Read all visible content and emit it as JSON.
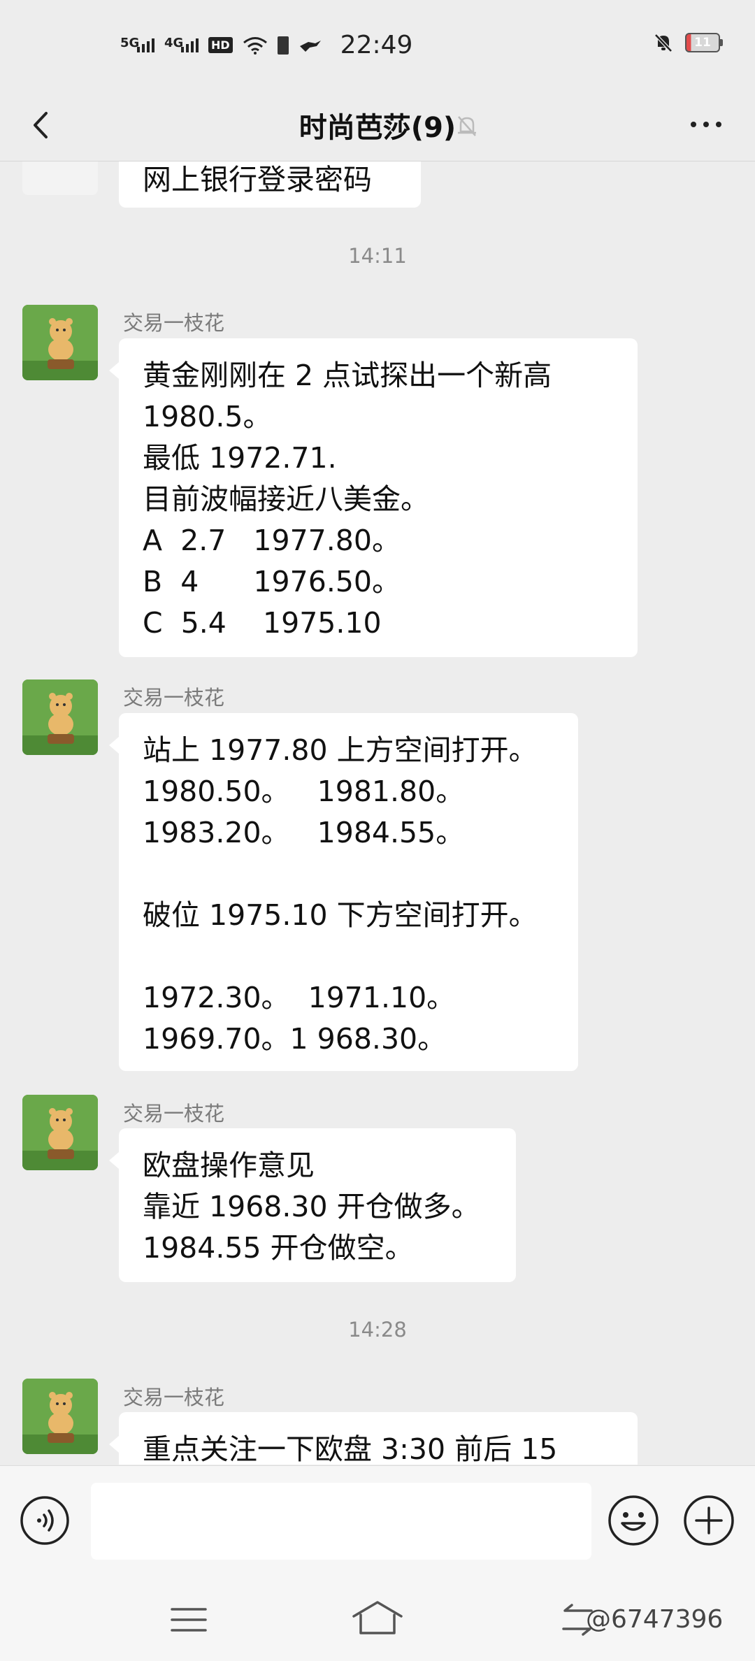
{
  "status_bar": {
    "net1": "5G",
    "net2": "4G",
    "hd": "HD",
    "time": "22:49",
    "battery_level": "11"
  },
  "header": {
    "title": "时尚芭莎(9)",
    "back_icon": "chevron-left-icon",
    "mute_icon": "bell-off-icon",
    "more_icon": "more-dots-icon"
  },
  "messages": [
    {
      "partial": true,
      "text": "网上银行登录密码"
    },
    {
      "timestamp": "14:11"
    },
    {
      "sender": "交易一枝花",
      "text": "黄金刚刚在 2 点试探出一个新高\n1980.5。\n最低 1972.71.\n目前波幅接近八美金。\nA  2.7   1977.80。\nB  4      1976.50。\nC  5.4    1975.10"
    },
    {
      "sender": "交易一枝花",
      "text": "站上 1977.80 上方空间打开。\n1980.50。   1981.80。\n1983.20。   1984.55。\n\n破位 1975.10 下方空间打开。\n\n1972.30。  1971.10。\n1969.70。1 968.30。"
    },
    {
      "sender": "交易一枝花",
      "text": "欧盘操作意见\n靠近 1968.30 开仓做多。\n1984.55 开仓做空。"
    },
    {
      "timestamp": "14:28"
    },
    {
      "sender": "交易一枝花",
      "text": "重点关注一下欧盘 3:30 前后 15"
    }
  ],
  "input_bar": {
    "placeholder": "",
    "voice_icon": "voice-icon",
    "emoji_icon": "emoji-icon",
    "plus_icon": "plus-icon"
  },
  "nav": {
    "menu_icon": "menu-icon",
    "home_icon": "home-icon",
    "back_icon": "back-icon",
    "watermark": "@6747396"
  }
}
